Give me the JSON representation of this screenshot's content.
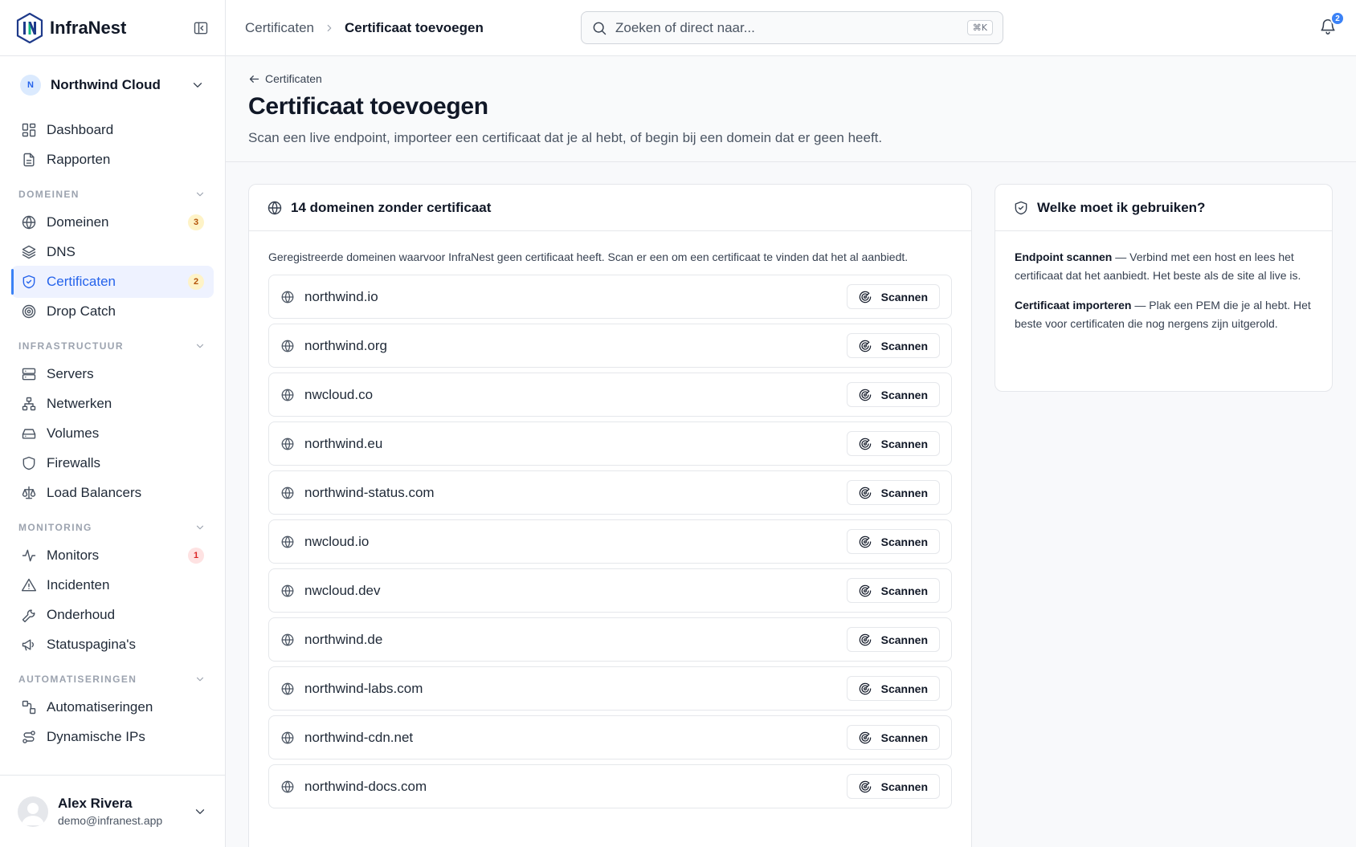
{
  "app": {
    "name": "InfraNest"
  },
  "org": {
    "initial": "N",
    "name": "Northwind Cloud"
  },
  "nav": {
    "top": [
      {
        "label": "Dashboard",
        "icon": "dashboard-icon"
      },
      {
        "label": "Rapporten",
        "icon": "report-icon"
      }
    ],
    "sections": [
      {
        "title": "DOMEINEN",
        "items": [
          {
            "label": "Domeinen",
            "icon": "globe-icon",
            "badge": "3",
            "badge_color": "amber"
          },
          {
            "label": "DNS",
            "icon": "layers-icon"
          },
          {
            "label": "Certificaten",
            "icon": "shield-check-icon",
            "badge": "2",
            "badge_color": "amber",
            "active": true
          },
          {
            "label": "Drop Catch",
            "icon": "target-icon"
          }
        ]
      },
      {
        "title": "INFRASTRUCTUUR",
        "items": [
          {
            "label": "Servers",
            "icon": "server-icon"
          },
          {
            "label": "Netwerken",
            "icon": "network-icon"
          },
          {
            "label": "Volumes",
            "icon": "drive-icon"
          },
          {
            "label": "Firewalls",
            "icon": "shield-icon"
          },
          {
            "label": "Load Balancers",
            "icon": "scale-icon"
          }
        ]
      },
      {
        "title": "MONITORING",
        "items": [
          {
            "label": "Monitors",
            "icon": "activity-icon",
            "badge": "1",
            "badge_color": "red"
          },
          {
            "label": "Incidenten",
            "icon": "alert-triangle-icon"
          },
          {
            "label": "Onderhoud",
            "icon": "wrench-icon"
          },
          {
            "label": "Statuspagina's",
            "icon": "megaphone-icon"
          }
        ]
      },
      {
        "title": "AUTOMATISERINGEN",
        "items": [
          {
            "label": "Automatiseringen",
            "icon": "workflow-icon"
          },
          {
            "label": "Dynamische IPs",
            "icon": "route-icon"
          }
        ]
      }
    ]
  },
  "user": {
    "name": "Alex Rivera",
    "email": "demo@infranest.app"
  },
  "topbar": {
    "breadcrumb_parent": "Certificaten",
    "breadcrumb_current": "Certificaat toevoegen",
    "search_placeholder": "Zoeken of direct naar...",
    "search_shortcut": "⌘K",
    "notifications_count": "2"
  },
  "page": {
    "back_label": "Certificaten",
    "title": "Certificaat toevoegen",
    "subtitle": "Scan een live endpoint, importeer een certificaat dat je al hebt, of begin bij een domein dat er geen heeft."
  },
  "main_card": {
    "title": "14 domeinen zonder certificaat",
    "description": "Geregistreerde domeinen waarvoor InfraNest geen certificaat heeft. Scan er een om een certificaat te vinden dat het al aanbiedt.",
    "scan_label": "Scannen",
    "domains": [
      "northwind.io",
      "northwind.org",
      "nwcloud.co",
      "northwind.eu",
      "northwind-status.com",
      "nwcloud.io",
      "nwcloud.dev",
      "northwind.de",
      "northwind-labs.com",
      "northwind-cdn.net",
      "northwind-docs.com"
    ]
  },
  "side_card": {
    "title": "Welke moet ik gebruiken?",
    "tips": [
      {
        "term": "Endpoint scannen",
        "text": " — Verbind met een host en lees het certificaat dat het aanbiedt. Het beste als de site al live is."
      },
      {
        "term": "Certificaat importeren",
        "text": " — Plak een PEM die je al hebt. Het beste voor certificaten die nog nergens zijn uitgerold."
      }
    ]
  },
  "colors": {
    "accent": "#2563eb",
    "badge_amber": "#fef3c7",
    "badge_red": "#fee2e2"
  }
}
